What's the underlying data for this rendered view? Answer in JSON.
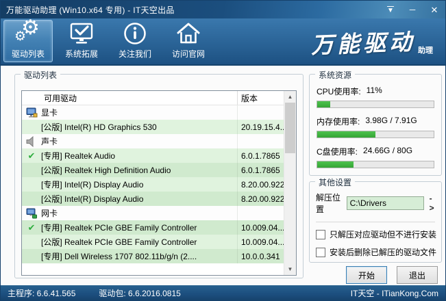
{
  "titlebar": {
    "title": "万能驱动助理 (Win10.x64 专用) - IT天空出品",
    "controls": {
      "skin": "▼",
      "minimize": "─",
      "close": "✕"
    }
  },
  "toolbar": {
    "items": [
      {
        "label": "驱动列表",
        "icon": "gears-icon",
        "active": true
      },
      {
        "label": "系统拓展",
        "icon": "system-monitor-check-icon",
        "active": false
      },
      {
        "label": "关注我们",
        "icon": "info-circle-icon",
        "active": false
      },
      {
        "label": "访问官网",
        "icon": "home-icon",
        "active": false
      }
    ],
    "logo_main": "万能驱动",
    "logo_sub": "助理"
  },
  "driver_panel": {
    "group_title": "驱动列表",
    "columns": {
      "name": "可用驱动",
      "version": "版本"
    },
    "rows": [
      {
        "type": "category",
        "icon": "display-adapter-icon",
        "name": "显卡",
        "version": "",
        "checked": false
      },
      {
        "type": "driver",
        "name": "[公版] Intel(R) HD Graphics 530",
        "version": "20.19.15.4...",
        "checked": false
      },
      {
        "type": "category",
        "icon": "speaker-icon",
        "name": "声卡",
        "version": "",
        "checked": false
      },
      {
        "type": "driver",
        "name": "[专用] Realtek Audio",
        "version": "6.0.1.7865",
        "checked": true
      },
      {
        "type": "driver",
        "name": "[公版] Realtek High Definition Audio",
        "version": "6.0.1.7865",
        "checked": false
      },
      {
        "type": "driver",
        "name": "[专用] Intel(R) Display Audio",
        "version": "8.20.00.922",
        "checked": false
      },
      {
        "type": "driver",
        "name": "[公版] Intel(R) Display Audio",
        "version": "8.20.00.922",
        "checked": false
      },
      {
        "type": "category",
        "icon": "network-adapter-icon",
        "name": "网卡",
        "version": "",
        "checked": false
      },
      {
        "type": "driver",
        "name": "[专用] Realtek PCIe GBE Family Controller",
        "version": "10.009.04...",
        "checked": true
      },
      {
        "type": "driver",
        "name": "[公版] Realtek PCIe GBE Family Controller",
        "version": "10.009.04...",
        "checked": false
      },
      {
        "type": "driver",
        "name": "[专用] Dell Wireless 1707 802.11b/g/n (2....",
        "version": "10.0.0.341",
        "checked": false
      }
    ]
  },
  "system_resources": {
    "group_title": "系统资源",
    "stats": [
      {
        "label": "CPU使用率:",
        "value": "11%",
        "percent": 11
      },
      {
        "label": "内存使用率:",
        "value": "3.98G / 7.91G",
        "percent": 50
      },
      {
        "label": "C盘使用率:",
        "value": "24.66G / 80G",
        "percent": 31
      }
    ]
  },
  "other_settings": {
    "group_title": "其他设置",
    "extract_label": "解压位置",
    "extract_path": "C:\\Drivers",
    "browse_label": "->",
    "checkboxes": [
      {
        "label": "只解压对应驱动但不进行安装",
        "checked": false
      },
      {
        "label": "安装后删除已解压的驱动文件",
        "checked": false
      }
    ]
  },
  "actions": {
    "start": "开始",
    "exit": "退出"
  },
  "statusbar": {
    "main_version": "主程序: 6.6.41.565",
    "pack_version": "驱动包: 6.6.2016.0815",
    "site": "IT天空 - ITianKong.Com"
  },
  "colors": {
    "titlebar_blue": "#1b4e7e",
    "toolbar_blue": "#2a6396",
    "row_green_dark": "#d0eace",
    "row_green_light": "#e0f3de",
    "progress_green": "#3fb23f",
    "check_green": "#2fae3f",
    "extract_field_green": "#d6edd6"
  }
}
